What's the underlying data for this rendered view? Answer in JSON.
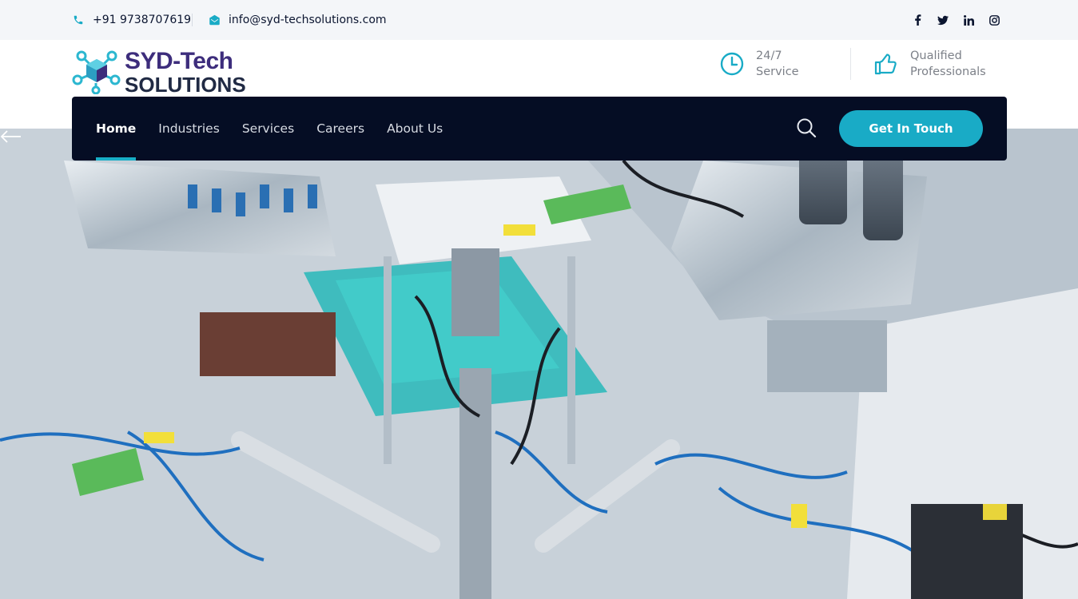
{
  "topbar": {
    "phone": "+91 9738707619",
    "email": "info@syd-techsolutions.com",
    "social": [
      {
        "name": "facebook",
        "glyph": "f"
      },
      {
        "name": "twitter",
        "glyph": "t"
      },
      {
        "name": "linkedin",
        "glyph": "in"
      },
      {
        "name": "instagram",
        "glyph": "ig"
      }
    ]
  },
  "logo": {
    "line1": "SYD-Tech",
    "line2": "SOLUTIONS"
  },
  "features": [
    {
      "icon": "clock-icon",
      "line1": "24/7",
      "line2": "Service"
    },
    {
      "icon": "thumbs-up-icon",
      "line1": "Qualified",
      "line2": "Professionals"
    }
  ],
  "nav": {
    "items": [
      {
        "label": "Home",
        "active": true
      },
      {
        "label": "Industries",
        "active": false
      },
      {
        "label": "Services",
        "active": false
      },
      {
        "label": "Careers",
        "active": false
      },
      {
        "label": "About Us",
        "active": false
      }
    ],
    "cta": "Get In Touch"
  },
  "colors": {
    "accent": "#19abc6",
    "nav_bg": "#050d24",
    "topbar_bg": "#f4f6f9",
    "logo_purple": "#3d2d7c"
  }
}
